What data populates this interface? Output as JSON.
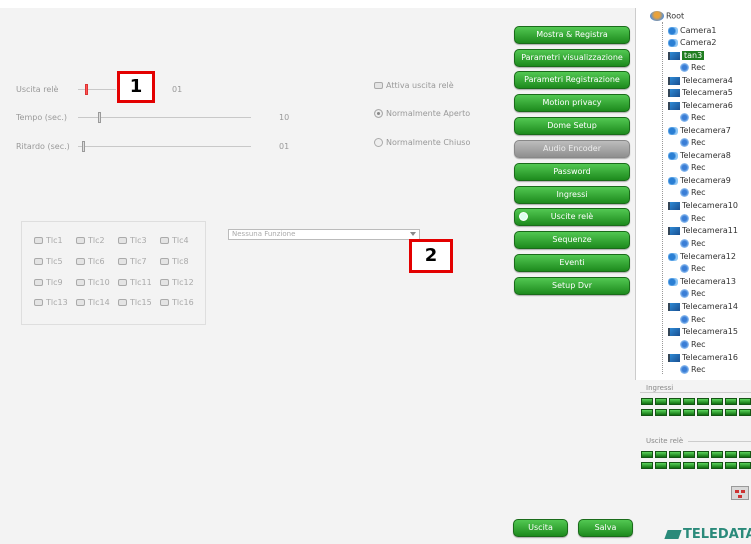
{
  "callouts": {
    "c1": "1",
    "c2": "2"
  },
  "form": {
    "uscita_rele": {
      "label": "Uscita relè",
      "value": "01"
    },
    "tempo": {
      "label": "Tempo (sec.)",
      "value": "10"
    },
    "ritardo": {
      "label": "Ritardo (sec.)",
      "value": "01"
    },
    "attiva_uscita": "Attiva uscita relè",
    "normalmente_aperto": "Normalmente Aperto",
    "normalmente_chiuso": "Normalmente Chiuso"
  },
  "tlc": [
    "Tlc1",
    "Tlc2",
    "Tlc3",
    "Tlc4",
    "Tlc5",
    "Tlc6",
    "Tlc7",
    "Tlc8",
    "Tlc9",
    "Tlc10",
    "Tlc11",
    "Tlc12",
    "Tlc13",
    "Tlc14",
    "Tlc15",
    "Tlc16"
  ],
  "dropdown": {
    "value": "Nessuna Funzione"
  },
  "menu": {
    "mostra_registra": "Mostra & Registra",
    "parametri_visualizzazione": "Parametri visualizzazione",
    "parametri_registrazione": "Parametri Registrazione",
    "motion_privacy": "Motion privacy",
    "dome_setup": "Dome Setup",
    "audio_encoder": "Audio Encoder",
    "password": "Password",
    "ingressi": "Ingressi",
    "uscite_rele": "Uscite relè",
    "sequenze": "Sequenze",
    "eventi": "Eventi",
    "setup_dvr": "Setup Dvr"
  },
  "footer": {
    "uscita": "Uscita",
    "salva": "Salva"
  },
  "tree": {
    "root": "Root",
    "camera1": "Camera1",
    "camera2": "Camera2",
    "selected": "tan3",
    "rec": "Rec",
    "cams": [
      "Telecamera4",
      "Telecamera5",
      "Telecamera6",
      "Telecamera7",
      "Telecamera8",
      "Telecamera9",
      "Telecamera10",
      "Telecamera11",
      "Telecamera12",
      "Telecamera13",
      "Telecamera14",
      "Telecamera15",
      "Telecamera16"
    ]
  },
  "status": {
    "ingressi": "Ingressi",
    "uscite_rele": "Uscite relè"
  },
  "brand": {
    "logo": "TELEDATA",
    "accent": "#1f8f1f"
  }
}
